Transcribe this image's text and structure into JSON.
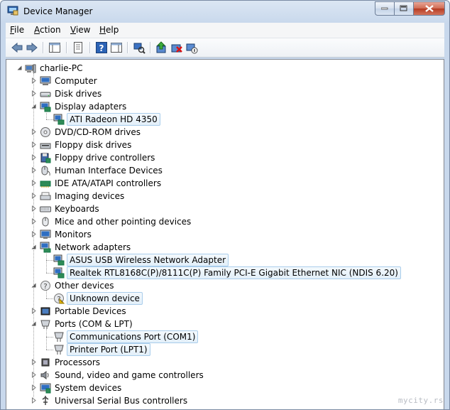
{
  "window": {
    "title": "Device Manager"
  },
  "menu": [
    {
      "key": "F",
      "rest": "ile"
    },
    {
      "key": "A",
      "rest": "ction"
    },
    {
      "key": "V",
      "rest": "iew"
    },
    {
      "key": "H",
      "rest": "elp"
    }
  ],
  "toolbar": {
    "icons": [
      "back-icon",
      "forward-icon",
      "show-hide-console-tree-icon",
      "properties-icon",
      "help-icon",
      "show-action-pane-icon",
      "scan-hardware-icon",
      "update-driver-icon",
      "uninstall-icon",
      "disable-device-icon"
    ]
  },
  "tree": {
    "root": "charlie-PC",
    "categories": [
      {
        "label": "Computer",
        "icon": "computer-icon",
        "expanded": false
      },
      {
        "label": "Disk drives",
        "icon": "disk-drive-icon",
        "expanded": false
      },
      {
        "label": "Display adapters",
        "icon": "display-adapter-icon",
        "expanded": true,
        "children": [
          "ATI Radeon HD 4350"
        ]
      },
      {
        "label": "DVD/CD-ROM drives",
        "icon": "dvd-drive-icon",
        "expanded": false
      },
      {
        "label": "Floppy disk drives",
        "icon": "floppy-drive-icon",
        "expanded": false
      },
      {
        "label": "Floppy drive controllers",
        "icon": "floppy-controller-icon",
        "expanded": false
      },
      {
        "label": "Human Interface Devices",
        "icon": "hid-icon",
        "expanded": false
      },
      {
        "label": "IDE ATA/ATAPI controllers",
        "icon": "ide-controller-icon",
        "expanded": false
      },
      {
        "label": "Imaging devices",
        "icon": "imaging-device-icon",
        "expanded": false
      },
      {
        "label": "Keyboards",
        "icon": "keyboard-icon",
        "expanded": false
      },
      {
        "label": "Mice and other pointing devices",
        "icon": "mouse-icon",
        "expanded": false
      },
      {
        "label": "Monitors",
        "icon": "monitor-icon",
        "expanded": false
      },
      {
        "label": "Network adapters",
        "icon": "network-adapter-icon",
        "expanded": true,
        "children": [
          "ASUS USB Wireless Network Adapter",
          "Realtek RTL8168C(P)/8111C(P) Family PCI-E Gigabit Ethernet NIC (NDIS 6.20)"
        ]
      },
      {
        "label": "Other devices",
        "icon": "other-devices-icon",
        "expanded": true,
        "children": [
          "Unknown device"
        ]
      },
      {
        "label": "Portable Devices",
        "icon": "portable-device-icon",
        "expanded": false
      },
      {
        "label": "Ports (COM & LPT)",
        "icon": "port-icon",
        "expanded": true,
        "children": [
          "Communications Port (COM1)",
          "Printer Port (LPT1)"
        ]
      },
      {
        "label": "Processors",
        "icon": "processor-icon",
        "expanded": false
      },
      {
        "label": "Sound, video and game controllers",
        "icon": "sound-icon",
        "expanded": false
      },
      {
        "label": "System devices",
        "icon": "system-devices-icon",
        "expanded": false
      },
      {
        "label": "Universal Serial Bus controllers",
        "icon": "usb-controller-icon",
        "expanded": false
      }
    ]
  },
  "watermark": "mycity.rs",
  "colors": {
    "selection_border": "#a9cdeb",
    "tree_line": "#a0a0a0"
  }
}
